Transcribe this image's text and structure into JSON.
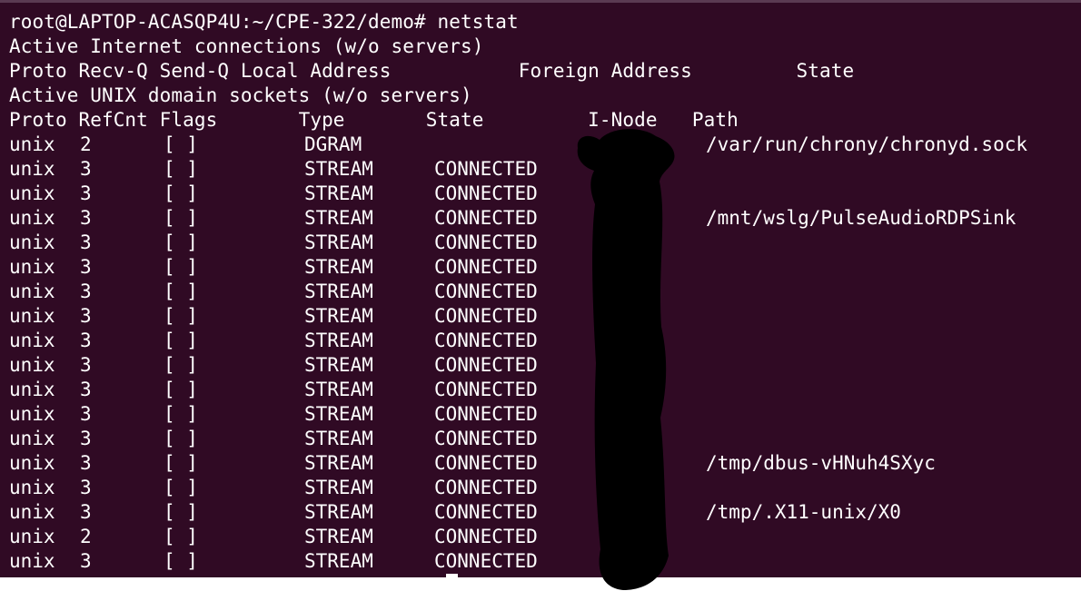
{
  "terminal": {
    "prompt_line": "root@LAPTOP-ACASQP4U:~/CPE-322/demo# netstat",
    "inet_title": "Active Internet connections (w/o servers)",
    "inet_header": "Proto Recv-Q Send-Q Local Address           Foreign Address         State",
    "unix_title": "Active UNIX domain sockets (w/o servers)",
    "unix_header": "Proto RefCnt Flags       Type       State         I-Node   Path",
    "rows": [
      {
        "proto": "unix",
        "refcnt": "2",
        "flags": "[ ]",
        "type": "DGRAM",
        "state": "",
        "path": "/var/run/chrony/chronyd.sock"
      },
      {
        "proto": "unix",
        "refcnt": "3",
        "flags": "[ ]",
        "type": "STREAM",
        "state": "CONNECTED",
        "path": ""
      },
      {
        "proto": "unix",
        "refcnt": "3",
        "flags": "[ ]",
        "type": "STREAM",
        "state": "CONNECTED",
        "path": ""
      },
      {
        "proto": "unix",
        "refcnt": "3",
        "flags": "[ ]",
        "type": "STREAM",
        "state": "CONNECTED",
        "path": "/mnt/wslg/PulseAudioRDPSink"
      },
      {
        "proto": "unix",
        "refcnt": "3",
        "flags": "[ ]",
        "type": "STREAM",
        "state": "CONNECTED",
        "path": ""
      },
      {
        "proto": "unix",
        "refcnt": "3",
        "flags": "[ ]",
        "type": "STREAM",
        "state": "CONNECTED",
        "path": ""
      },
      {
        "proto": "unix",
        "refcnt": "3",
        "flags": "[ ]",
        "type": "STREAM",
        "state": "CONNECTED",
        "path": ""
      },
      {
        "proto": "unix",
        "refcnt": "3",
        "flags": "[ ]",
        "type": "STREAM",
        "state": "CONNECTED",
        "path": ""
      },
      {
        "proto": "unix",
        "refcnt": "3",
        "flags": "[ ]",
        "type": "STREAM",
        "state": "CONNECTED",
        "path": ""
      },
      {
        "proto": "unix",
        "refcnt": "3",
        "flags": "[ ]",
        "type": "STREAM",
        "state": "CONNECTED",
        "path": ""
      },
      {
        "proto": "unix",
        "refcnt": "3",
        "flags": "[ ]",
        "type": "STREAM",
        "state": "CONNECTED",
        "path": ""
      },
      {
        "proto": "unix",
        "refcnt": "3",
        "flags": "[ ]",
        "type": "STREAM",
        "state": "CONNECTED",
        "path": ""
      },
      {
        "proto": "unix",
        "refcnt": "3",
        "flags": "[ ]",
        "type": "STREAM",
        "state": "CONNECTED",
        "path": ""
      },
      {
        "proto": "unix",
        "refcnt": "3",
        "flags": "[ ]",
        "type": "STREAM",
        "state": "CONNECTED",
        "path": "/tmp/dbus-vHNuh4SXyc"
      },
      {
        "proto": "unix",
        "refcnt": "3",
        "flags": "[ ]",
        "type": "STREAM",
        "state": "CONNECTED",
        "path": ""
      },
      {
        "proto": "unix",
        "refcnt": "3",
        "flags": "[ ]",
        "type": "STREAM",
        "state": "CONNECTED",
        "path": "/tmp/.X11-unix/X0"
      },
      {
        "proto": "unix",
        "refcnt": "2",
        "flags": "[ ]",
        "type": "STREAM",
        "state": "CONNECTED",
        "path": ""
      },
      {
        "proto": "unix",
        "refcnt": "3",
        "flags": "[ ]",
        "type": "STREAM",
        "state": "CONNECTED",
        "path": ""
      }
    ]
  },
  "colors": {
    "background": "#300a24",
    "text": "#ffffff",
    "redaction": "#000000"
  }
}
